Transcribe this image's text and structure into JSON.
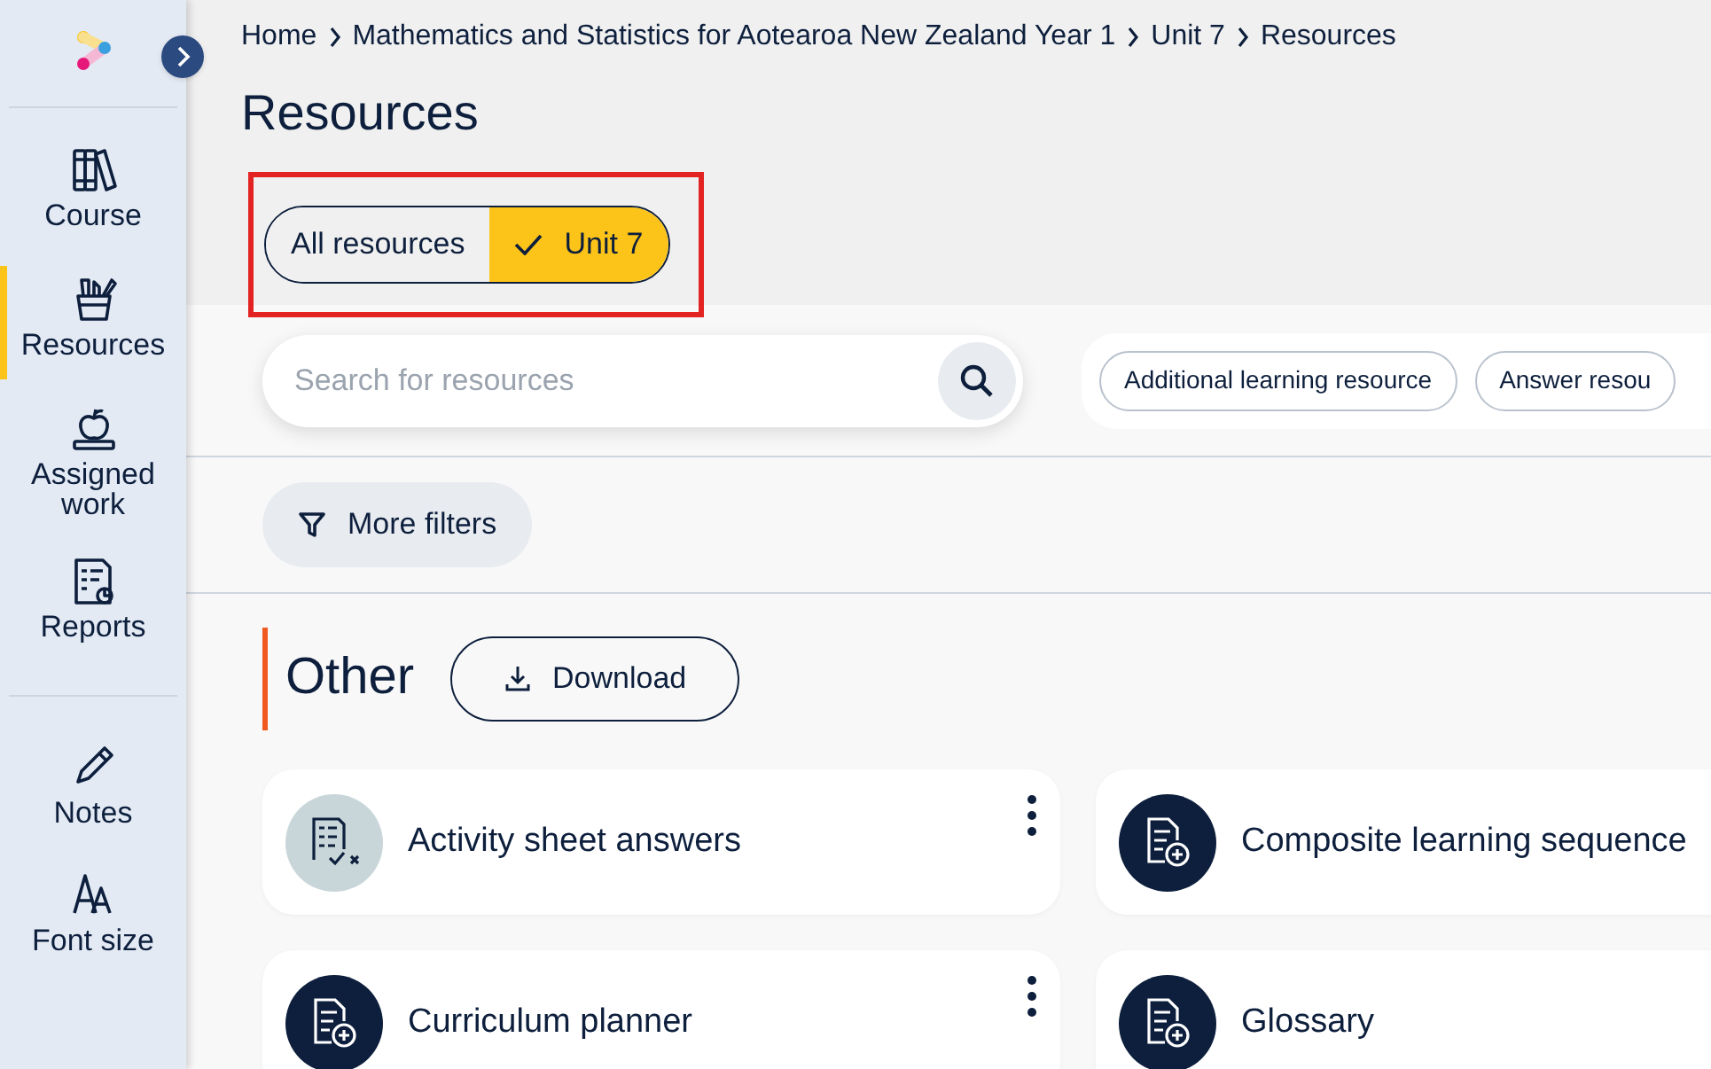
{
  "sidebar": {
    "items": [
      {
        "label": "Course",
        "kind": "course",
        "selected": false
      },
      {
        "label": "Resources",
        "kind": "resources",
        "selected": true
      },
      {
        "label": "Assigned work",
        "kind": "assigned",
        "selected": false
      },
      {
        "label": "Reports",
        "kind": "reports",
        "selected": false
      }
    ],
    "tools": [
      {
        "label": "Notes",
        "kind": "notes"
      },
      {
        "label": "Font size",
        "kind": "font"
      }
    ]
  },
  "breadcrumb": [
    "Home",
    "Mathematics and Statistics for Aotearoa New Zealand Year 1",
    "Unit 7",
    "Resources"
  ],
  "page_title": "Resources",
  "scope_toggle": [
    {
      "label": "All resources",
      "selected": false
    },
    {
      "label": "Unit 7",
      "selected": true
    }
  ],
  "search": {
    "placeholder": "Search for resources"
  },
  "filter_chips": [
    "Additional learning resource",
    "Answer resou"
  ],
  "more_filters": "More filters",
  "section": {
    "title": "Other",
    "download": "Download",
    "cards": [
      {
        "title": "Activity sheet answers",
        "kind": "answers",
        "menu": true
      },
      {
        "title": "Composite learning sequence",
        "kind": "document",
        "menu": false
      },
      {
        "title": "Curriculum planner",
        "kind": "document",
        "menu": true
      },
      {
        "title": "Glossary",
        "kind": "document",
        "menu": false
      }
    ]
  }
}
